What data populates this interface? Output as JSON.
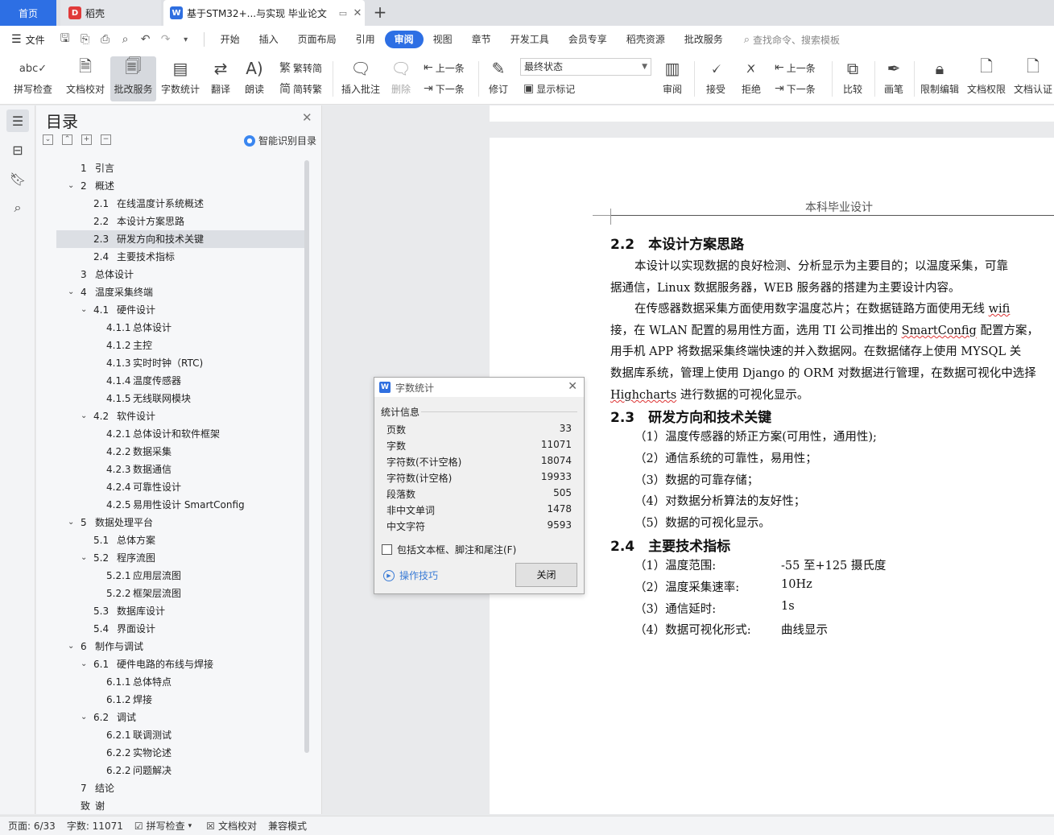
{
  "tabs": {
    "home": "首页",
    "daoke": "稻壳",
    "doc_title": "基于STM32+...与实现 毕业论文"
  },
  "menu": {
    "file": "文件",
    "items": [
      "开始",
      "插入",
      "页面布局",
      "引用",
      "审阅",
      "视图",
      "章节",
      "开发工具",
      "会员专享",
      "稻壳资源",
      "批改服务"
    ],
    "active": "审阅",
    "search": "查找命令、搜索模板"
  },
  "ribbon": {
    "spell_check": "拼写检查",
    "doc_proof": "文档校对",
    "correction_service": "批改服务",
    "word_count": "字数统计",
    "translate": "翻译",
    "read_aloud": "朗读",
    "trad_to_simp": "繁转简",
    "simp_to_trad": "简转繁",
    "insert_comment": "插入批注",
    "delete": "删除",
    "prev_comment": "上一条",
    "next_comment": "下一条",
    "revise": "修订",
    "final_state": "最终状态",
    "show_markup": "显示标记",
    "review": "审阅",
    "accept": "接受",
    "reject": "拒绝",
    "prev_change": "上一条",
    "next_change": "下一条",
    "compare": "比较",
    "pen": "画笔",
    "restrict_edit": "限制编辑",
    "doc_permission": "文档权限",
    "doc_certify": "文档认证"
  },
  "toc": {
    "title": "目录",
    "smart_recognize": "智能识别目录",
    "items": [
      {
        "num": "1",
        "text": "引言",
        "level": 1
      },
      {
        "num": "2",
        "text": "概述",
        "level": 1
      },
      {
        "num": "2.1",
        "text": "在线温度计系统概述",
        "level": 2
      },
      {
        "num": "2.2",
        "text": "本设计方案思路",
        "level": 2
      },
      {
        "num": "2.3",
        "text": "研发方向和技术关键",
        "level": 2
      },
      {
        "num": "2.4",
        "text": "主要技术指标",
        "level": 2
      },
      {
        "num": "3",
        "text": "总体设计",
        "level": 1
      },
      {
        "num": "4",
        "text": "温度采集终端",
        "level": 1
      },
      {
        "num": "4.1",
        "text": "硬件设计",
        "level": 2
      },
      {
        "num": "4.1.1",
        "text": "总体设计",
        "level": 3
      },
      {
        "num": "4.1.2",
        "text": "主控",
        "level": 3
      },
      {
        "num": "4.1.3",
        "text": "实时时钟（RTC)",
        "level": 3
      },
      {
        "num": "4.1.4",
        "text": "温度传感器",
        "level": 3
      },
      {
        "num": "4.1.5",
        "text": "无线联网模块",
        "level": 3
      },
      {
        "num": "4.2",
        "text": "软件设计",
        "level": 2
      },
      {
        "num": "4.2.1",
        "text": "总体设计和软件框架",
        "level": 3
      },
      {
        "num": "4.2.2",
        "text": "数据采集",
        "level": 3
      },
      {
        "num": "4.2.3",
        "text": "数据通信",
        "level": 3
      },
      {
        "num": "4.2.4",
        "text": "可靠性设计",
        "level": 3
      },
      {
        "num": "4.2.5",
        "text": "易用性设计 SmartConfig",
        "level": 3
      },
      {
        "num": "5",
        "text": "数据处理平台",
        "level": 1
      },
      {
        "num": "5.1",
        "text": "总体方案",
        "level": 2
      },
      {
        "num": "5.2",
        "text": "程序流图",
        "level": 2
      },
      {
        "num": "5.2.1",
        "text": "应用层流图",
        "level": 3
      },
      {
        "num": "5.2.2",
        "text": "框架层流图",
        "level": 3
      },
      {
        "num": "5.3",
        "text": "数据库设计",
        "level": 2
      },
      {
        "num": "5.4",
        "text": "界面设计",
        "level": 2
      },
      {
        "num": "6",
        "text": "制作与调试",
        "level": 1
      },
      {
        "num": "6.1",
        "text": "硬件电路的布线与焊接",
        "level": 2
      },
      {
        "num": "6.1.1",
        "text": "总体特点",
        "level": 3
      },
      {
        "num": "6.1.2",
        "text": "焊接",
        "level": 3
      },
      {
        "num": "6.2",
        "text": "调试",
        "level": 2
      },
      {
        "num": "6.2.1",
        "text": "联调测试",
        "level": 3
      },
      {
        "num": "6.2.2",
        "text": "实物论述",
        "level": 3
      },
      {
        "num": "6.2.2",
        "text": "问题解决",
        "level": 3
      },
      {
        "num": "7",
        "text": "结论",
        "level": 1
      },
      {
        "num": "致",
        "text": "谢",
        "level": 1
      }
    ],
    "selected_index": 4
  },
  "document": {
    "header": "本科毕业设计",
    "h_2_2": "2.2　本设计方案思路",
    "p1_l1": "本设计以实现数据的良好检测、分析显示为主要目的；以温度采集，可靠",
    "p1_l2": "据通信，Linux 数据服务器，WEB 服务器的搭建为主要设计内容。",
    "p2_l1a": "在传感器数据采集方面使用数字温度芯片；在数据链路方面使用无线 ",
    "p2_l1b": "wifi",
    "p2_l2a": "接，在 WLAN 配置的易用性方面，选用 TI 公司推出的 ",
    "p2_l2b": "SmartConfig",
    "p2_l2c": " 配置方案，",
    "p2_l3": "用手机 APP 将数据采集终端快速的并入数据网。在数据储存上使用 MYSQL 关",
    "p2_l4": "数据库系统，管理上使用 Django 的 ORM 对数据进行管理，在数据可视化中选择",
    "p2_l5a": "Highcharts",
    "p2_l5b": " 进行数据的可视化显示。",
    "h_2_3": "2.3　研发方向和技术关键",
    "list_2_3": [
      "（1）温度传感器的矫正方案(可用性，通用性);",
      "（2）通信系统的可靠性，易用性；",
      "（3）数据的可靠存储；",
      "（4）对数据分析算法的友好性；",
      "（5）数据的可视化显示。"
    ],
    "h_2_4": "2.4　主要技术指标",
    "specs": [
      {
        "label": "（1）温度范围:",
        "value": "-55 至+125 摄氏度"
      },
      {
        "label": "（2）温度采集速率:",
        "value": "10Hz"
      },
      {
        "label": "（3）通信延时:",
        "value": "1s"
      },
      {
        "label": "（4）数据可视化形式:",
        "value": "曲线显示"
      }
    ]
  },
  "dialog": {
    "title": "字数统计",
    "group": "统计信息",
    "stats": [
      {
        "label": "页数",
        "value": "33"
      },
      {
        "label": "字数",
        "value": "11071"
      },
      {
        "label": "字符数(不计空格)",
        "value": "18074"
      },
      {
        "label": "字符数(计空格)",
        "value": "19933"
      },
      {
        "label": "段落数",
        "value": "505"
      },
      {
        "label": "非中文单词",
        "value": "1478"
      },
      {
        "label": "中文字符",
        "value": "9593"
      }
    ],
    "checkbox": "包括文本框、脚注和尾注(F)",
    "tips": "操作技巧",
    "close": "关闭"
  },
  "status": {
    "page": "页面: 6/33",
    "words": "字数: 11071",
    "spell": "拼写检查",
    "proof": "文档校对",
    "compat": "兼容模式"
  }
}
